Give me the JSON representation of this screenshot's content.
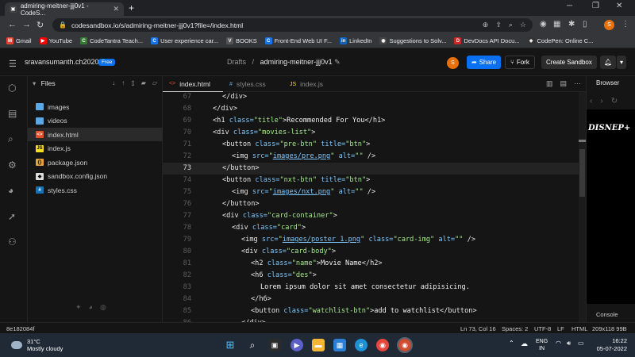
{
  "browser": {
    "tab_title": "admiring-meitner-jjj0v1 - CodeS...",
    "url": "codesandbox.io/s/admiring-meitner-jjj0v1?file=/index.html",
    "profile_initial": "S",
    "bookmarks": [
      {
        "label": "Gmail",
        "color": "#ea4335",
        "glyph": "M"
      },
      {
        "label": "YouTube",
        "color": "#ff0000",
        "glyph": "▶"
      },
      {
        "label": "CodeTantra Teach...",
        "color": "#2e7d32",
        "glyph": "C"
      },
      {
        "label": "User experience car...",
        "color": "#1a73e8",
        "glyph": "C"
      },
      {
        "label": "BOOKS",
        "color": "#555555",
        "glyph": "V"
      },
      {
        "label": "Front-End Web UI F...",
        "color": "#1a73e8",
        "glyph": "C"
      },
      {
        "label": "LinkedIn",
        "color": "#0a66c2",
        "glyph": "in"
      },
      {
        "label": "Suggestions to Solv...",
        "color": "#444444",
        "glyph": "◉"
      },
      {
        "label": "DevDocs API Docu...",
        "color": "#c62828",
        "glyph": "D"
      },
      {
        "label": "CodePen: Online C...",
        "color": "#333333",
        "glyph": "◈"
      }
    ]
  },
  "header": {
    "username": "sravansumanth.ch2020",
    "badge": "Free",
    "crumb_folder": "Drafts",
    "crumb_sep": "/",
    "sandbox_name": "admiring-meitner-jjj0v1",
    "avatar_initial": "S",
    "share_label": "Share",
    "fork_label": "Fork",
    "create_label": "Create Sandbox"
  },
  "files": {
    "title": "Files",
    "items": [
      {
        "name": "images",
        "type": "folder",
        "selected": false
      },
      {
        "name": "videos",
        "type": "folder",
        "selected": false
      },
      {
        "name": "index.html",
        "type": "html",
        "selected": true
      },
      {
        "name": "index.js",
        "type": "js",
        "selected": false
      },
      {
        "name": "package.json",
        "type": "json",
        "selected": false
      },
      {
        "name": "sandbox.config.json",
        "type": "config",
        "selected": false
      },
      {
        "name": "styles.css",
        "type": "css",
        "selected": false
      }
    ]
  },
  "editor": {
    "tabs": [
      {
        "label": "index.html",
        "icon": "<>",
        "active": true
      },
      {
        "label": "styles.css",
        "icon": "#",
        "active": false
      },
      {
        "label": "index.js",
        "icon": "JS",
        "active": false
      }
    ],
    "current_line": 73,
    "lines": [
      {
        "n": 67,
        "indent": 4,
        "parts": [
          [
            "tg",
            "</div>"
          ]
        ]
      },
      {
        "n": 68,
        "indent": 2,
        "parts": [
          [
            "tg",
            "</div>"
          ]
        ]
      },
      {
        "n": 69,
        "indent": 2,
        "parts": [
          [
            "tg",
            "<h1 "
          ],
          [
            "at",
            "class="
          ],
          [
            "st",
            "\"title\""
          ],
          [
            "tg",
            ">"
          ],
          [
            "tx",
            "Recommended For You"
          ],
          [
            "tg",
            "</h1>"
          ]
        ]
      },
      {
        "n": 70,
        "indent": 2,
        "parts": [
          [
            "tg",
            "<div "
          ],
          [
            "at",
            "class="
          ],
          [
            "st",
            "\"movies-list\""
          ],
          [
            "tg",
            ">"
          ]
        ]
      },
      {
        "n": 71,
        "indent": 4,
        "parts": [
          [
            "tg",
            "<button "
          ],
          [
            "at",
            "class="
          ],
          [
            "st",
            "\"pre-btn\""
          ],
          [
            "at",
            " title="
          ],
          [
            "st",
            "\"btn\""
          ],
          [
            "tg",
            ">"
          ]
        ]
      },
      {
        "n": 72,
        "indent": 6,
        "parts": [
          [
            "tg",
            "<img "
          ],
          [
            "at",
            "src="
          ],
          [
            "st",
            "\""
          ],
          [
            "lk",
            "images/pre.png"
          ],
          [
            "st",
            "\""
          ],
          [
            "at",
            " alt="
          ],
          [
            "st",
            "\"\""
          ],
          [
            "tg",
            " />"
          ]
        ]
      },
      {
        "n": 73,
        "indent": 4,
        "parts": [
          [
            "tg",
            "</button>"
          ]
        ]
      },
      {
        "n": 74,
        "indent": 4,
        "parts": [
          [
            "tg",
            "<button "
          ],
          [
            "at",
            "class="
          ],
          [
            "st",
            "\"nxt-btn\""
          ],
          [
            "at",
            " title="
          ],
          [
            "st",
            "\"btn\""
          ],
          [
            "tg",
            ">"
          ]
        ]
      },
      {
        "n": 75,
        "indent": 6,
        "parts": [
          [
            "tg",
            "<img "
          ],
          [
            "at",
            "src="
          ],
          [
            "st",
            "\""
          ],
          [
            "lk",
            "images/nxt.png"
          ],
          [
            "st",
            "\""
          ],
          [
            "at",
            " alt="
          ],
          [
            "st",
            "\"\""
          ],
          [
            "tg",
            " />"
          ]
        ]
      },
      {
        "n": 76,
        "indent": 4,
        "parts": [
          [
            "tg",
            "</button>"
          ]
        ]
      },
      {
        "n": 77,
        "indent": 4,
        "parts": [
          [
            "tg",
            "<div "
          ],
          [
            "at",
            "class="
          ],
          [
            "st",
            "\"card-container\""
          ],
          [
            "tg",
            ">"
          ]
        ]
      },
      {
        "n": 78,
        "indent": 6,
        "parts": [
          [
            "tg",
            "<div "
          ],
          [
            "at",
            "class="
          ],
          [
            "st",
            "\"card\""
          ],
          [
            "tg",
            ">"
          ]
        ]
      },
      {
        "n": 79,
        "indent": 8,
        "parts": [
          [
            "tg",
            "<img "
          ],
          [
            "at",
            "src="
          ],
          [
            "st",
            "\""
          ],
          [
            "lk",
            "images/poster 1.png"
          ],
          [
            "st",
            "\""
          ],
          [
            "at",
            " class="
          ],
          [
            "st",
            "\"card-img\""
          ],
          [
            "at",
            " alt="
          ],
          [
            "st",
            "\"\""
          ],
          [
            "tg",
            " />"
          ]
        ]
      },
      {
        "n": 80,
        "indent": 8,
        "parts": [
          [
            "tg",
            "<div "
          ],
          [
            "at",
            "class="
          ],
          [
            "st",
            "\"card-body\""
          ],
          [
            "tg",
            ">"
          ]
        ]
      },
      {
        "n": 81,
        "indent": 10,
        "parts": [
          [
            "tg",
            "<h2 "
          ],
          [
            "at",
            "class="
          ],
          [
            "st",
            "\"name\""
          ],
          [
            "tg",
            ">"
          ],
          [
            "tx",
            "Movie Name"
          ],
          [
            "tg",
            "</h2>"
          ]
        ]
      },
      {
        "n": 82,
        "indent": 10,
        "parts": [
          [
            "tg",
            "<h6 "
          ],
          [
            "at",
            "class="
          ],
          [
            "st",
            "\"des\""
          ],
          [
            "tg",
            ">"
          ]
        ]
      },
      {
        "n": 83,
        "indent": 12,
        "parts": [
          [
            "tx",
            "Lorem ipsum dolor sit amet consectetur adipisicing."
          ]
        ]
      },
      {
        "n": 84,
        "indent": 10,
        "parts": [
          [
            "tg",
            "</h6>"
          ]
        ]
      },
      {
        "n": 85,
        "indent": 10,
        "parts": [
          [
            "tg",
            "<button "
          ],
          [
            "at",
            "class="
          ],
          [
            "st",
            "\"watchlist-btn\""
          ],
          [
            "tg",
            ">"
          ],
          [
            "tx",
            "add to watchlist"
          ],
          [
            "tg",
            "</button>"
          ]
        ]
      },
      {
        "n": 86,
        "indent": 8,
        "parts": [
          [
            "tg",
            "</div>"
          ]
        ]
      }
    ]
  },
  "preview": {
    "title": "Browser",
    "logo_text": "DISNEP+",
    "console_label": "Console"
  },
  "statusbar": {
    "commit": "8e182084f",
    "position": "Ln 73, Col 16",
    "spaces": "Spaces: 2",
    "encoding": "UTF-8",
    "eol": "LF",
    "language": "HTML",
    "size": "209x118 99B"
  },
  "taskbar": {
    "temp": "31°C",
    "weather": "Mostly cloudy",
    "lang": "ENG",
    "region": "IN",
    "time": "16:22",
    "date": "05-07-2022"
  }
}
